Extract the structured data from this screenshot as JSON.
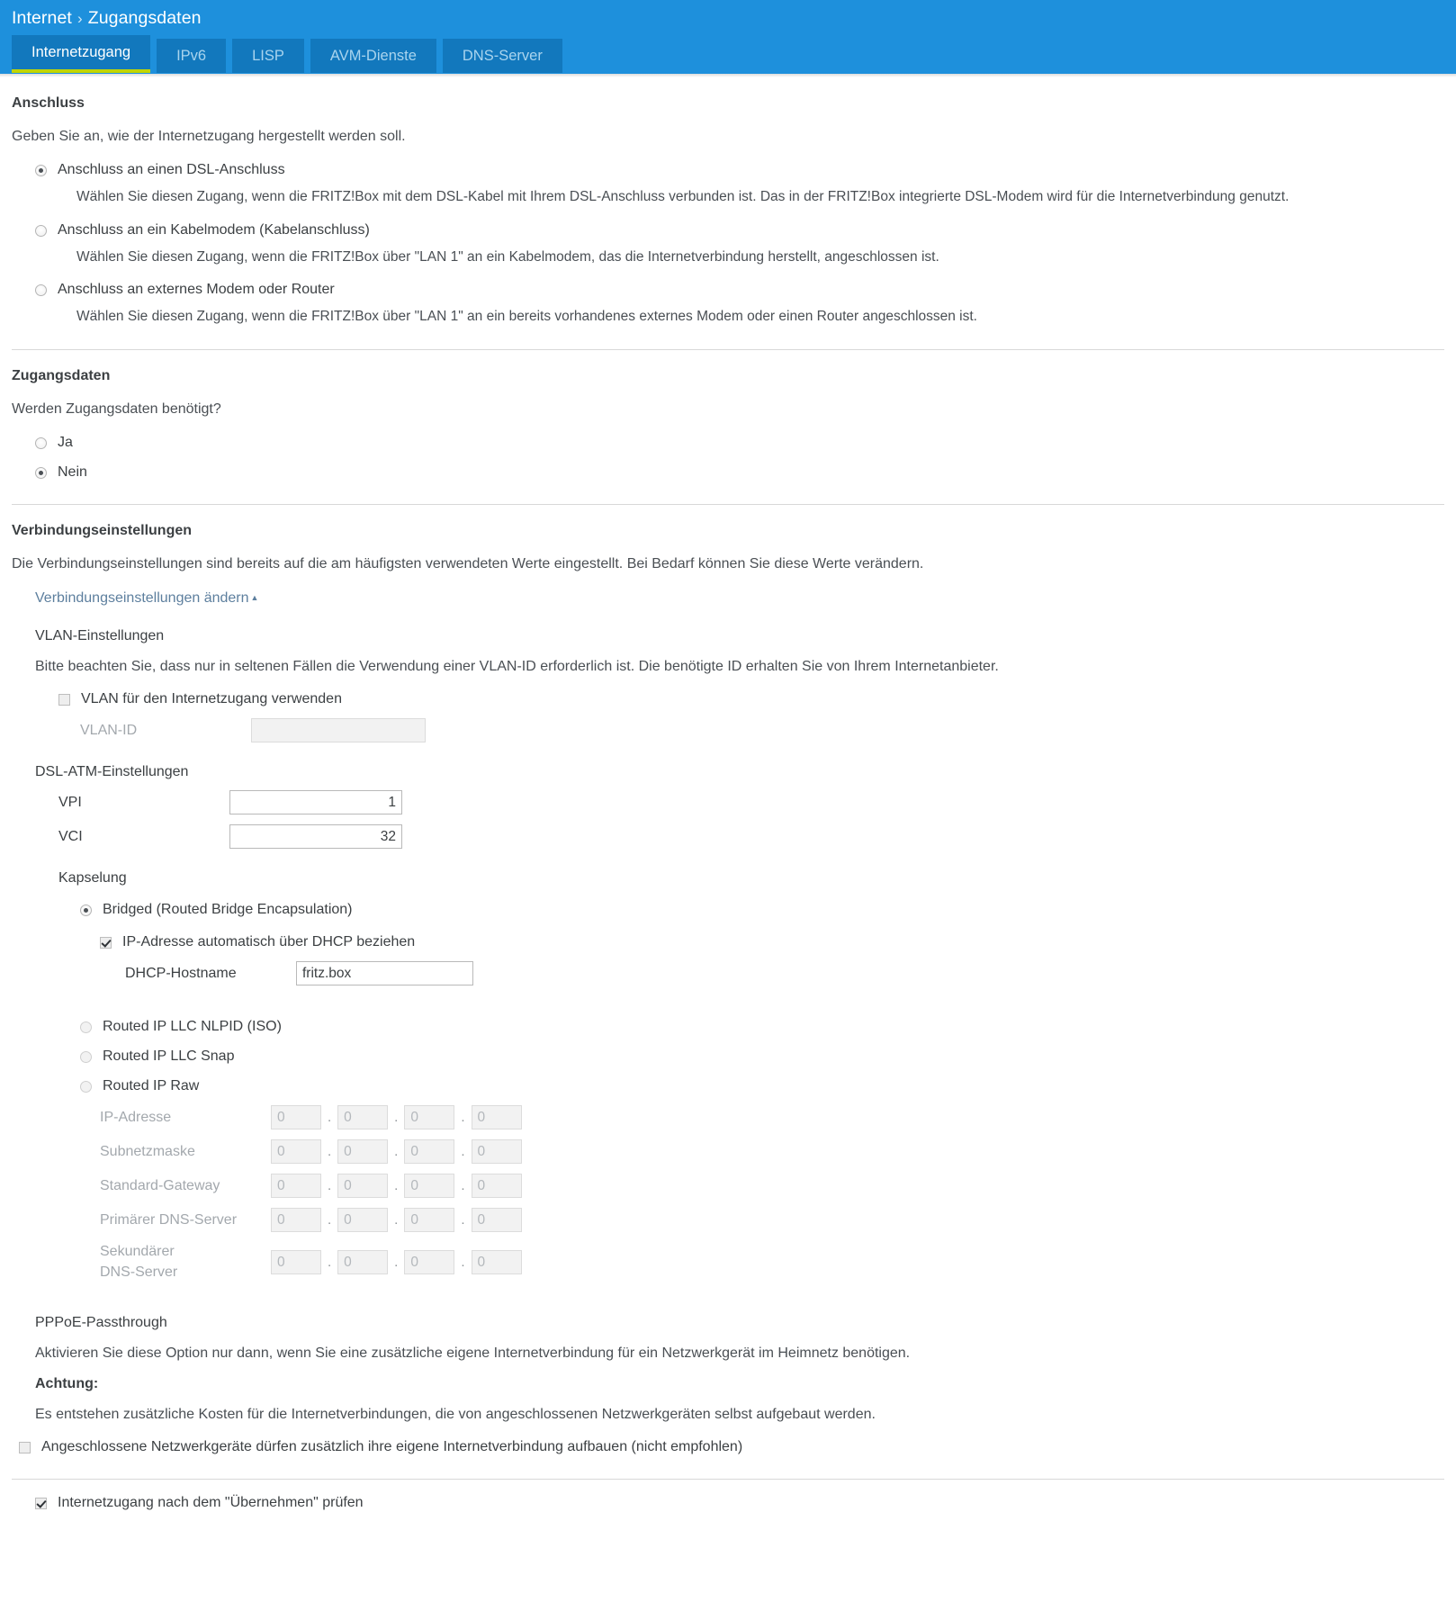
{
  "header": {
    "breadcrumb": {
      "root": "Internet",
      "separator": "›",
      "current": "Zugangsdaten"
    },
    "tabs": [
      {
        "label": "Internetzugang",
        "active": true
      },
      {
        "label": "IPv6",
        "active": false
      },
      {
        "label": "LISP",
        "active": false
      },
      {
        "label": "AVM-Dienste",
        "active": false
      },
      {
        "label": "DNS-Server",
        "active": false
      }
    ],
    "colors": {
      "bar": "#1e90dc",
      "tab": "#1278bd",
      "active_underline": "#c2d500",
      "tab_text": "#a9d4ee"
    }
  },
  "anschluss": {
    "title": "Anschluss",
    "intro": "Geben Sie an, wie der Internetzugang hergestellt werden soll.",
    "options": [
      {
        "label": "Anschluss an einen DSL-Anschluss",
        "checked": true,
        "description": "Wählen Sie diesen Zugang, wenn die FRITZ!Box mit dem DSL-Kabel mit Ihrem DSL-Anschluss verbunden ist. Das in der FRITZ!Box integrierte DSL-Modem wird für die Internetverbindung genutzt."
      },
      {
        "label": "Anschluss an ein Kabelmodem (Kabelanschluss)",
        "checked": false,
        "description": "Wählen Sie diesen Zugang, wenn die FRITZ!Box über \"LAN 1\" an ein Kabelmodem, das die Internetverbindung herstellt, angeschlossen ist."
      },
      {
        "label": "Anschluss an externes Modem oder Router",
        "checked": false,
        "description": "Wählen Sie diesen Zugang, wenn die FRITZ!Box über \"LAN 1\" an ein bereits vorhandenes externes Modem oder einen Router angeschlossen ist."
      }
    ]
  },
  "zugangsdaten": {
    "title": "Zugangsdaten",
    "question": "Werden Zugangsdaten benötigt?",
    "options": [
      {
        "label": "Ja",
        "checked": false
      },
      {
        "label": "Nein",
        "checked": true
      }
    ]
  },
  "verbindungseinstellungen": {
    "title": "Verbindungseinstellungen",
    "intro": "Die Verbindungseinstellungen sind bereits auf die am häufigsten verwendeten Werte eingestellt. Bei Bedarf können Sie diese Werte verändern.",
    "toggle_link": "Verbindungseinstellungen ändern",
    "toggle_caret": "▲",
    "vlan": {
      "title": "VLAN-Einstellungen",
      "note": "Bitte beachten Sie, dass nur in seltenen Fällen die Verwendung einer VLAN-ID erforderlich ist. Die benötigte ID erhalten Sie von Ihrem Internetanbieter.",
      "use_vlan_label": "VLAN für den Internetzugang verwenden",
      "use_vlan_checked": false,
      "vlan_id_label": "VLAN-ID",
      "vlan_id_value": "",
      "vlan_id_disabled": true
    },
    "atm": {
      "title": "DSL-ATM-Einstellungen",
      "vpi_label": "VPI",
      "vpi_value": "1",
      "vci_label": "VCI",
      "vci_value": "32"
    },
    "kapselung": {
      "title": "Kapselung",
      "bridged": {
        "label": "Bridged (Routed Bridge Encapsulation)",
        "checked": true,
        "dhcp_label": "IP-Adresse automatisch über DHCP beziehen",
        "dhcp_checked": true,
        "hostname_label": "DHCP-Hostname",
        "hostname_value": "fritz.box"
      },
      "other_options": [
        {
          "label": "Routed IP LLC NLPID (ISO)",
          "checked": false
        },
        {
          "label": "Routed IP LLC Snap",
          "checked": false
        },
        {
          "label": "Routed IP Raw",
          "checked": false
        }
      ],
      "ip_fields": [
        {
          "label": "IP-Adresse",
          "octets": [
            "0",
            "0",
            "0",
            "0"
          ]
        },
        {
          "label": "Subnetzmaske",
          "octets": [
            "0",
            "0",
            "0",
            "0"
          ]
        },
        {
          "label": "Standard-Gateway",
          "octets": [
            "0",
            "0",
            "0",
            "0"
          ]
        },
        {
          "label": "Primärer DNS-Server",
          "octets": [
            "0",
            "0",
            "0",
            "0"
          ]
        },
        {
          "label": "Sekundärer DNS-Server",
          "octets": [
            "0",
            "0",
            "0",
            "0"
          ]
        }
      ],
      "octet_separator": "."
    },
    "pppoe": {
      "title": "PPPoE-Passthrough",
      "note": "Aktivieren Sie diese Option nur dann, wenn Sie eine zusätzliche eigene Internetverbindung für ein Netzwerkgerät im Heimnetz benötigen.",
      "warning_title": "Achtung:",
      "warning_text": "Es entstehen zusätzliche Kosten für die Internetverbindungen, die von angeschlossenen Netzwerkgeräten selbst aufgebaut werden.",
      "checkbox_label": "Angeschlossene Netzwerkgeräte dürfen zusätzlich ihre eigene Internetverbindung aufbauen (nicht empfohlen)",
      "checkbox_checked": false
    }
  },
  "footer": {
    "check_label": "Internetzugang nach dem \"Übernehmen\" prüfen",
    "check_checked": true
  }
}
